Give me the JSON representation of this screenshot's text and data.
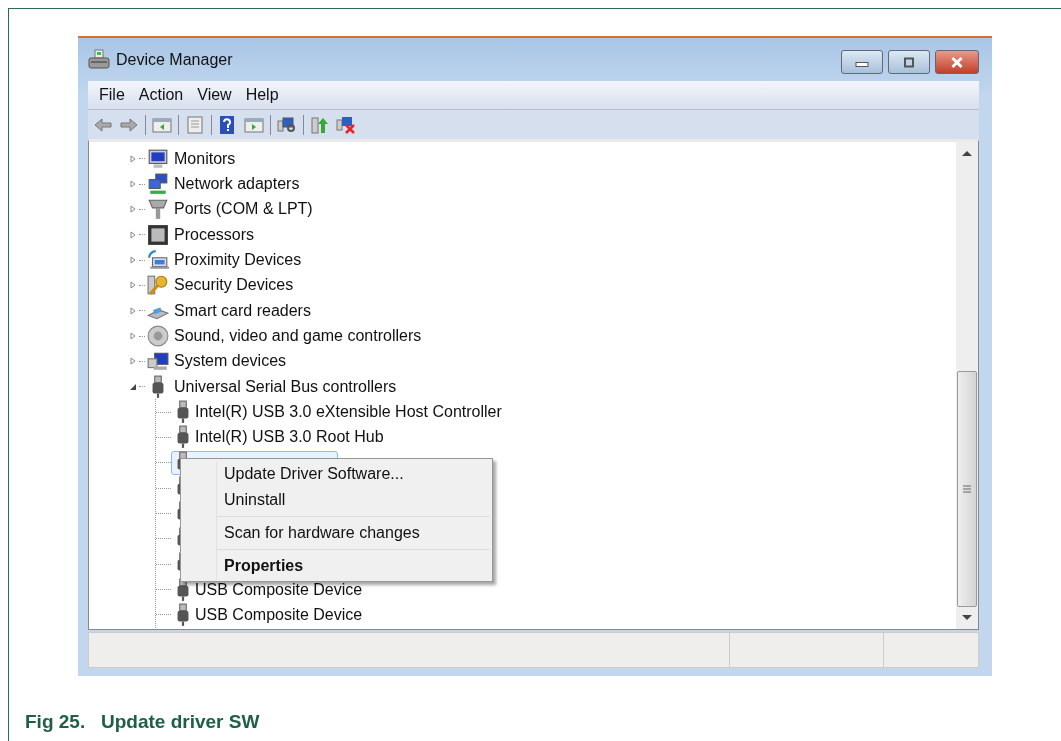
{
  "window": {
    "title": "Device Manager"
  },
  "menu": [
    "File",
    "Action",
    "View",
    "Help"
  ],
  "tree": [
    {
      "label": "Monitors",
      "kind": "monitor",
      "expanded": false
    },
    {
      "label": "Network adapters",
      "kind": "network",
      "expanded": false
    },
    {
      "label": "Ports (COM & LPT)",
      "kind": "port",
      "expanded": false
    },
    {
      "label": "Processors",
      "kind": "processor",
      "expanded": false
    },
    {
      "label": "Proximity Devices",
      "kind": "proximity",
      "expanded": false
    },
    {
      "label": "Security Devices",
      "kind": "security",
      "expanded": false
    },
    {
      "label": "Smart card readers",
      "kind": "smartcard",
      "expanded": false
    },
    {
      "label": "Sound, video and game controllers",
      "kind": "sound",
      "expanded": false
    },
    {
      "label": "System devices",
      "kind": "system",
      "expanded": false
    },
    {
      "label": "Universal Serial Bus controllers",
      "kind": "usb",
      "expanded": true,
      "children": [
        {
          "label": "Intel(R) USB 3.0 eXtensible Host Controller",
          "kind": "usb",
          "selected": false
        },
        {
          "label": "Intel(R) USB 3.0 Root Hub",
          "kind": "usb",
          "selected": false
        },
        {
          "kind": "usb",
          "selected": true
        },
        {
          "kind": "usb",
          "selected": false
        },
        {
          "kind": "usb",
          "selected": false
        },
        {
          "kind": "usb",
          "selected": false
        },
        {
          "kind": "usb",
          "selected": false
        },
        {
          "label": "USB Composite Device",
          "kind": "usb",
          "selected": false
        },
        {
          "label": "USB Composite Device",
          "kind": "usb",
          "selected": false
        }
      ]
    }
  ],
  "context_menu": [
    {
      "label": "Update Driver Software...",
      "default": false
    },
    {
      "label": "Uninstall",
      "default": false,
      "separator_after": true
    },
    {
      "label": "Scan for hardware changes",
      "default": false,
      "separator_after": true
    },
    {
      "label": "Properties",
      "default": true
    }
  ],
  "caption": "Fig 25.   Update driver SW"
}
